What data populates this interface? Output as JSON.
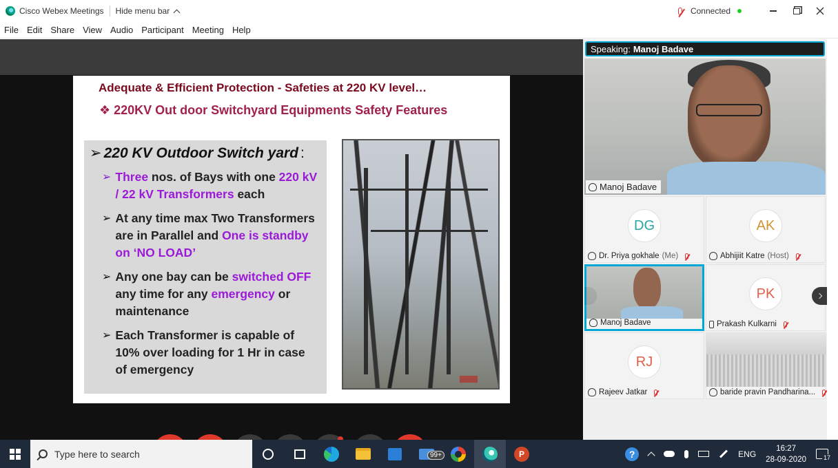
{
  "window": {
    "app_title": "Cisco Webex Meetings",
    "hide_menu_label": "Hide menu bar",
    "connection_status": "Connected"
  },
  "menu": [
    "File",
    "Edit",
    "Share",
    "View",
    "Audio",
    "Participant",
    "Meeting",
    "Help"
  ],
  "slide": {
    "title": "Adequate & Efficient Protection - Safeties at 220 KV level…",
    "subtitle": "❖ 220KV Out door Switchyard Equipments Safety Features",
    "heading": "220 KV Outdoor Switch yard",
    "heading_suffix": ":",
    "items": [
      [
        {
          "t": "Three",
          "hl": true
        },
        {
          "t": " nos. of  Bays with one  ",
          "hl": false
        },
        {
          "t": "220 kV / 22 kV Transformers",
          "hl": true
        },
        {
          "t": " each",
          "hl": false
        }
      ],
      [
        {
          "t": "At any time max Two Transformers are in Parallel and ",
          "hl": false
        },
        {
          "t": "One is standby on ‘NO LOAD’",
          "hl": true
        }
      ],
      [
        {
          "t": "Any one bay can be ",
          "hl": false
        },
        {
          "t": "switched OFF",
          "hl": true
        },
        {
          "t": " any time for any ",
          "hl": false
        },
        {
          "t": "emergency",
          "hl": true
        },
        {
          "t": " or maintenance",
          "hl": false
        }
      ],
      [
        {
          "t": "Each Transformer is capable of 10% over loading for 1 Hr in case of emergency",
          "hl": false
        }
      ]
    ]
  },
  "speaking": {
    "prefix": "Speaking:",
    "name": "Manoj Badave"
  },
  "main_video_label": "Manoj Badave",
  "participants": [
    {
      "initials": "DG",
      "name": "Dr. Priya gokhale",
      "role": "(Me)",
      "muted": true,
      "kind": "avatar",
      "color": "#2aa5a0"
    },
    {
      "initials": "AK",
      "name": "Abhijiit Katre",
      "role": "(Host)",
      "muted": true,
      "kind": "avatar",
      "color": "#d39230"
    },
    {
      "initials": "",
      "name": "Manoj Badave",
      "role": "",
      "muted": false,
      "kind": "video",
      "color": ""
    },
    {
      "initials": "PK",
      "name": "Prakash Kulkarni",
      "role": "",
      "muted": true,
      "kind": "avatar",
      "color": "#e0604a"
    },
    {
      "initials": "RJ",
      "name": "Rajeev Jatkar",
      "role": "",
      "muted": true,
      "kind": "avatar",
      "color": "#e0604a"
    },
    {
      "initials": "",
      "name": "baride pravin Pandharina...",
      "role": "",
      "muted": true,
      "kind": "roof",
      "color": ""
    }
  ],
  "controls": [
    {
      "name": "mute-button",
      "icon": "mic-off-icon",
      "style": "red"
    },
    {
      "name": "video-button",
      "icon": "video-off-icon",
      "style": "red"
    },
    {
      "name": "share-button",
      "icon": "share-icon",
      "style": "dark"
    },
    {
      "name": "participants-button",
      "icon": "participants-icon",
      "style": "dark"
    },
    {
      "name": "chat-button",
      "icon": "chat-icon",
      "style": "dark"
    },
    {
      "name": "more-button",
      "icon": "more-icon",
      "style": "dark"
    },
    {
      "name": "leave-button",
      "icon": "close-icon",
      "style": "red"
    }
  ],
  "taskbar": {
    "search_placeholder": "Type here to search",
    "mail_badge": "99+",
    "ppt_letter": "P",
    "language": "ENG",
    "time": "16:27",
    "date": "28-09-2020",
    "notification_count": "17",
    "help_glyph": "?"
  },
  "colors": {
    "accent": "#00a8d6",
    "control_red": "#e0392b",
    "slide_title": "#7a0a1e",
    "slide_highlight": "#9b1ad8"
  }
}
